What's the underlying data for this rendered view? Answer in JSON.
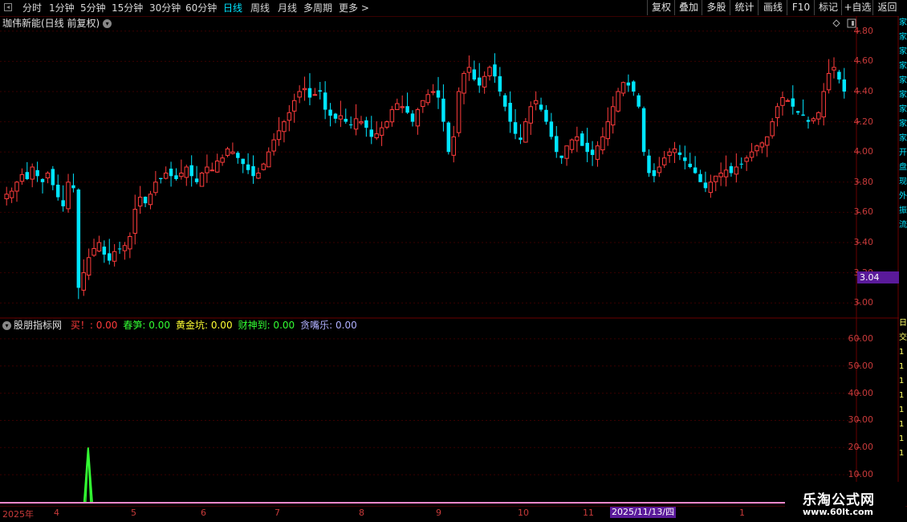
{
  "toolbar": {
    "periods": [
      "分时",
      "1分钟",
      "5分钟",
      "15分钟",
      "30分钟",
      "60分钟",
      "日线",
      "周线",
      "月线",
      "多周期",
      "更多 >"
    ],
    "active_period": "日线",
    "buttons": [
      "复权",
      "叠加",
      "多股",
      "统计",
      "画线",
      "F10",
      "标记",
      "+自选",
      "返回"
    ]
  },
  "main_chart": {
    "title": "珈伟新能(日线 前复权)",
    "y_ticks": [
      "4.80",
      "4.60",
      "4.40",
      "4.20",
      "4.00",
      "3.80",
      "3.60",
      "3.40",
      "3.20",
      "3.00"
    ],
    "current_price_tag": "3.04"
  },
  "indicator": {
    "name": "股朋指标网",
    "items": [
      {
        "label": "买！",
        "value": "0.00",
        "color": "#ff3b3b"
      },
      {
        "label": "春笋",
        "value": "0.00",
        "color": "#33ff33"
      },
      {
        "label": "黄金坑",
        "value": "0.00",
        "color": "#ffff33"
      },
      {
        "label": "财神到",
        "value": "0.00",
        "color": "#33ff33"
      },
      {
        "label": "贪嘴乐",
        "value": "0.00",
        "color": "#b0b0ff"
      }
    ],
    "y_ticks": [
      "60.00",
      "50.00",
      "40.00",
      "30.00",
      "20.00",
      "10.00"
    ]
  },
  "date_axis": {
    "labels": [
      "2025年",
      "4",
      "5",
      "6",
      "7",
      "8",
      "9",
      "10",
      "11",
      "1"
    ],
    "cursor_date": "2025/11/13/四"
  },
  "right_strip_chars": [
    "家",
    "家",
    "家",
    "家",
    "家",
    "家",
    "家",
    "家",
    "家",
    "开",
    "盘",
    "现",
    "外",
    "振",
    "流"
  ],
  "right_strip_chars_lower": [
    "日",
    "交",
    "1",
    "1",
    "1",
    "1",
    "1",
    "1",
    "1",
    "1"
  ],
  "watermark": {
    "line1": "乐淘公式网",
    "line2": "www.60lt.com"
  },
  "colors": {
    "up": "#ff3c3c",
    "down": "#00e5ff",
    "grid": "#3a0000",
    "axis": "#c83a3a",
    "green_line": "#33ff33",
    "magenta_line": "#ff88cc"
  },
  "chart_data": {
    "type": "candlestick",
    "title": "珈伟新能(日线 前复权)",
    "ylim": [
      2.9,
      4.9
    ],
    "close_series_approx": [
      3.72,
      3.74,
      3.8,
      3.85,
      3.82,
      3.9,
      3.84,
      3.8,
      3.86,
      3.78,
      3.7,
      3.64,
      3.8,
      3.76,
      3.1,
      3.2,
      3.3,
      3.36,
      3.4,
      3.32,
      3.28,
      3.34,
      3.36,
      3.38,
      3.44,
      3.62,
      3.7,
      3.66,
      3.72,
      3.8,
      3.82,
      3.86,
      3.84,
      3.82,
      3.86,
      3.9,
      3.84,
      3.8,
      3.86,
      3.9,
      3.88,
      3.94,
      3.96,
      4.02,
      4.0,
      3.96,
      3.92,
      3.88,
      3.84,
      3.86,
      3.92,
      4.0,
      4.08,
      4.14,
      4.2,
      4.26,
      4.34,
      4.4,
      4.42,
      4.36,
      4.38,
      4.4,
      4.28,
      4.24,
      4.22,
      4.24,
      4.2,
      4.18,
      4.22,
      4.2,
      4.16,
      4.1,
      4.12,
      4.16,
      4.2,
      4.28,
      4.32,
      4.3,
      4.26,
      4.2,
      4.28,
      4.34,
      4.38,
      4.4,
      4.36,
      4.2,
      4.0,
      4.1,
      4.4,
      4.52,
      4.56,
      4.48,
      4.44,
      4.5,
      4.56,
      4.5,
      4.4,
      4.3,
      4.2,
      4.12,
      4.08,
      4.2,
      4.3,
      4.34,
      4.28,
      4.2,
      4.1,
      4.0,
      3.96,
      4.04,
      4.08,
      4.1,
      4.04,
      4.0,
      3.98,
      4.04,
      4.1,
      4.2,
      4.3,
      4.4,
      4.46,
      4.44,
      4.4,
      4.3,
      4.0,
      3.86,
      3.84,
      3.9,
      3.96,
      4.0,
      4.02,
      3.98,
      3.94,
      3.9,
      3.86,
      3.8,
      3.76,
      3.8,
      3.84,
      3.86,
      3.88,
      3.86,
      3.9,
      3.92,
      3.96,
      4.0,
      4.04,
      4.06,
      4.1,
      4.2,
      4.3,
      4.36,
      4.34,
      4.3,
      4.26,
      4.24,
      4.2,
      4.22,
      4.26,
      4.4,
      4.52,
      4.56,
      4.48,
      4.4
    ],
    "indicator_series": [
      {
        "name": "春笋",
        "peak": 20,
        "peak_index": 14
      }
    ]
  }
}
